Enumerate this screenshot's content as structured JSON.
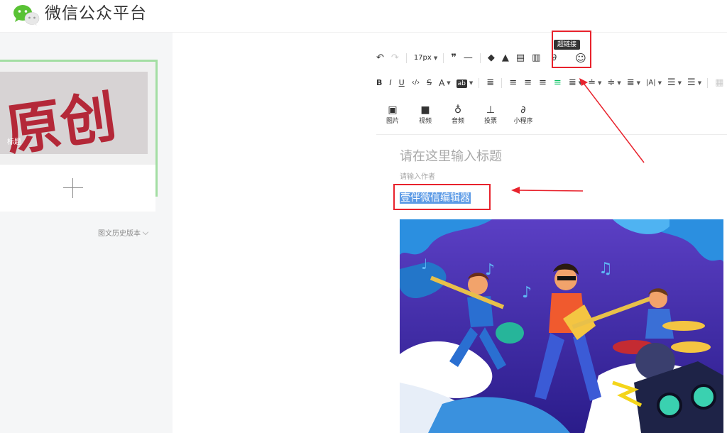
{
  "header": {
    "brand": "微信公众平台"
  },
  "sidebar": {
    "cover_watermark": "原创",
    "cover_title": "标题",
    "history_label": "图文历史版本"
  },
  "toolbar": {
    "font_size": "17px",
    "hyperlink_tooltip": "超链接",
    "highlight_label": "ab"
  },
  "insert": {
    "items": [
      {
        "icon": "image-icon",
        "label": "图片"
      },
      {
        "icon": "video-icon",
        "label": "视频"
      },
      {
        "icon": "microphone-icon",
        "label": "音频"
      },
      {
        "icon": "poll-icon",
        "label": "投票"
      },
      {
        "icon": "mini-program-icon",
        "label": "小程序"
      }
    ]
  },
  "editor": {
    "title_placeholder": "请在这里输入标题",
    "author_placeholder": "请输入作者",
    "body_selected_text": "壹伴微信编辑器"
  },
  "colors": {
    "annotation_red": "#e8222c",
    "selection_blue": "#5d9be6",
    "card_border_green": "#a3dea3"
  }
}
